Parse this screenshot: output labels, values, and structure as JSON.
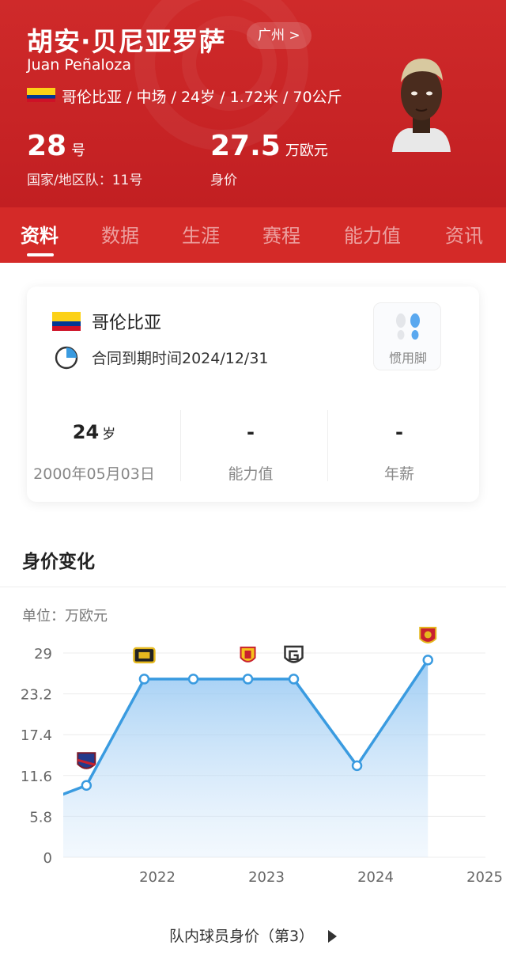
{
  "player": {
    "name_cn": "胡安·贝尼亚罗萨",
    "name_en": "Juan Peñaloza",
    "city": "广州 >",
    "info": "哥伦比亚 / 中场 / 24岁 / 1.72米 / 70公斤",
    "shirt_number": "28",
    "shirt_unit": "号",
    "national_team": "国家/地区队：11号",
    "market_value": "27.5",
    "market_value_unit": "万欧元",
    "market_value_label": "身价"
  },
  "tabs": [
    {
      "label": "资料",
      "active": true
    },
    {
      "label": "数据",
      "active": false
    },
    {
      "label": "生涯",
      "active": false
    },
    {
      "label": "赛程",
      "active": false
    },
    {
      "label": "能力值",
      "active": false
    },
    {
      "label": "资讯",
      "active": false
    }
  ],
  "card": {
    "country": "哥伦比亚",
    "contract": "合同到期时间2024/12/31",
    "foot_label": "惯用脚",
    "stats": [
      {
        "value": "24",
        "unit": "岁",
        "label": "2000年05月03日"
      },
      {
        "value": "-",
        "unit": "",
        "label": "能力值"
      },
      {
        "value": "-",
        "unit": "",
        "label": "年薪"
      }
    ]
  },
  "section_title": "身价变化",
  "unit_label": "单位：万欧元",
  "footer_link": "队内球员身价（第3）",
  "colors": {
    "header_red": "#c8232a",
    "line_blue": "#3a9be0",
    "flag_yellow": "#fcd116",
    "flag_blue": "#003893",
    "flag_red": "#ce1126"
  },
  "chart_data": {
    "type": "area",
    "title": "",
    "xlabel": "",
    "ylabel": "",
    "x_ticks": [
      "2022",
      "2023",
      "2024",
      "2025"
    ],
    "y_ticks": [
      "0",
      "5.8",
      "11.6",
      "17.4",
      "23.2",
      "29"
    ],
    "ylim": [
      0,
      29
    ],
    "xlim": [
      2021.0,
      2025.0
    ],
    "grid": true,
    "series": [
      {
        "x": [
          2020.6,
          2021.35,
          2021.88,
          2022.33,
          2022.83,
          2023.25,
          2023.83,
          2024.48
        ],
        "values": [
          5.8,
          10.2,
          25.3,
          25.3,
          25.3,
          25.3,
          13.0,
          28.0
        ],
        "markers": [
          false,
          true,
          true,
          true,
          true,
          true,
          true,
          true
        ]
      }
    ],
    "club_badges": [
      {
        "x": 2021.35,
        "icon": "huesca-badge-icon"
      },
      {
        "x": 2021.88,
        "icon": "black-yellow-club-badge-icon"
      },
      {
        "x": 2022.83,
        "icon": "yellow-red-club-badge-icon"
      },
      {
        "x": 2023.25,
        "icon": "gray-club-badge-icon"
      },
      {
        "x": 2024.48,
        "icon": "guangzhou-badge-icon"
      }
    ]
  }
}
